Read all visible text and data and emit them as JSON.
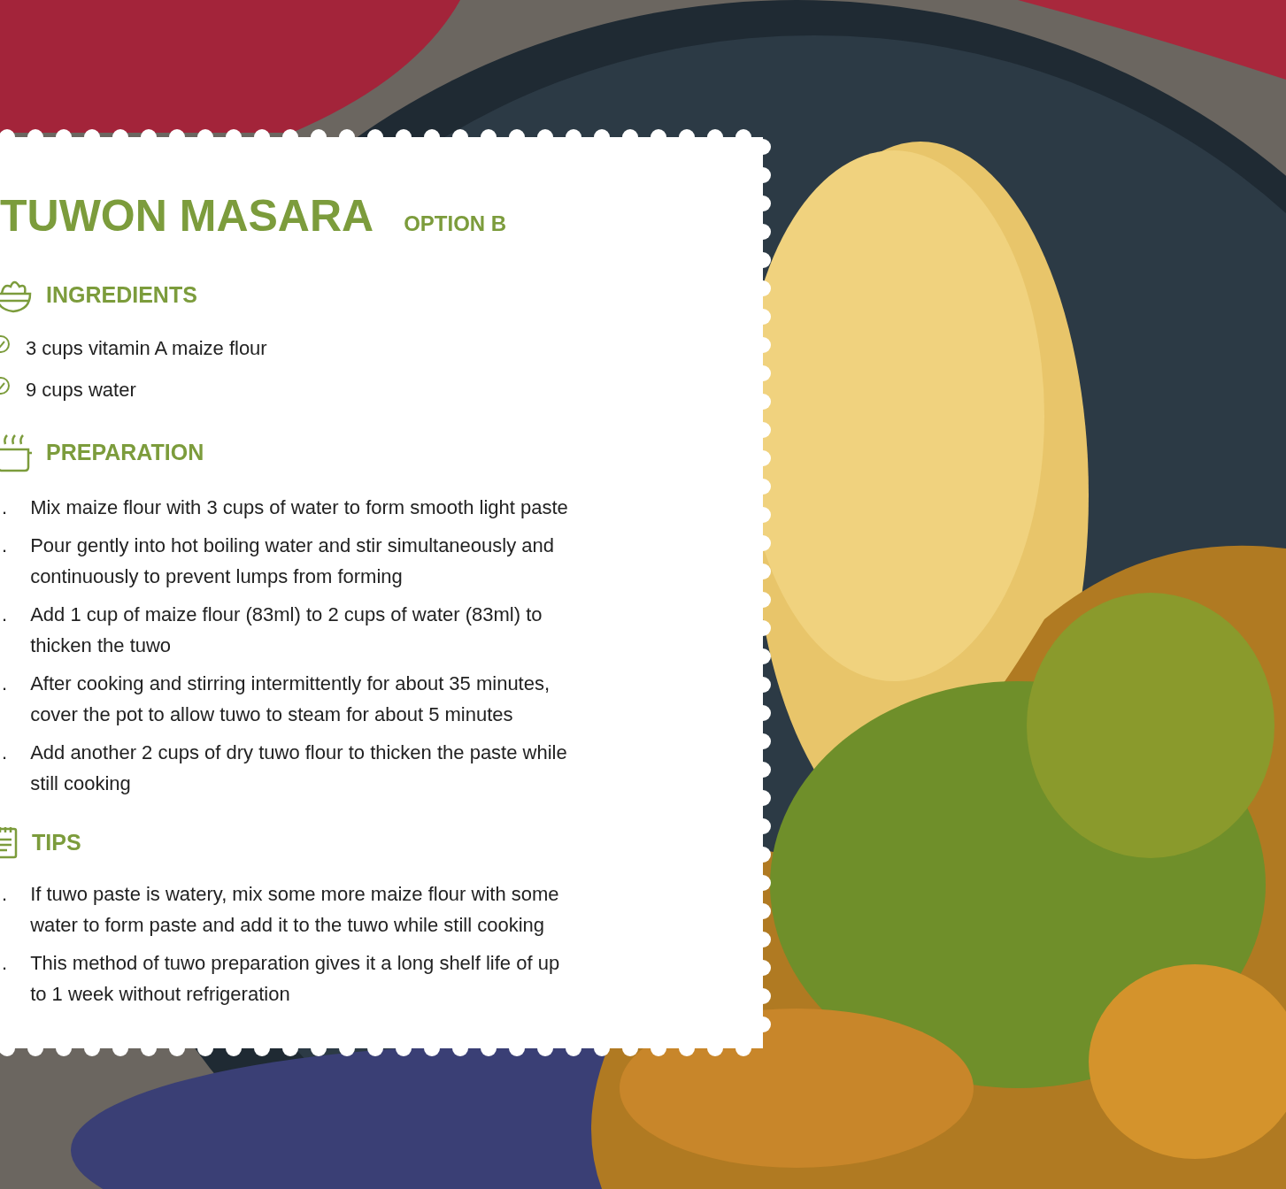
{
  "title": "TUWON MASARA",
  "subtitle": "OPTION B",
  "sections": [
    {
      "kind": "ingredients",
      "heading": "INGREDIENTS",
      "items": [
        {
          "lines": [
            "3 cups vitamin A maize flour"
          ]
        },
        {
          "lines": [
            "9 cups water"
          ]
        }
      ]
    },
    {
      "kind": "preparation",
      "heading": "PREPARATION",
      "items": [
        {
          "marker": ".",
          "lines": [
            "Mix maize flour with 3 cups of water to form smooth light paste"
          ]
        },
        {
          "marker": ".",
          "lines": [
            "Pour gently into hot boiling water and stir simultaneously and",
            "continuously to prevent lumps from forming"
          ]
        },
        {
          "marker": ".",
          "lines": [
            "Add 1 cup of maize flour (83ml) to 2 cups of water (83ml) to",
            "thicken the tuwo"
          ]
        },
        {
          "marker": ".",
          "lines": [
            "After cooking and stirring intermittently for about 35 minutes,",
            "cover the pot to allow tuwo to steam for about 5 minutes"
          ]
        },
        {
          "marker": ".",
          "lines": [
            "Add another 2 cups of dry tuwo flour to thicken the paste while",
            "still cooking"
          ]
        }
      ]
    },
    {
      "kind": "tips",
      "heading": "TIPS",
      "items": [
        {
          "marker": ".",
          "lines": [
            "If tuwo paste is watery, mix some more maize flour with some",
            "water to form paste and add it to the tuwo while still cooking"
          ]
        },
        {
          "marker": ".",
          "lines": [
            "This method of tuwo preparation gives it a long shelf life of up",
            "to 1 week without refrigeration"
          ]
        }
      ]
    }
  ]
}
